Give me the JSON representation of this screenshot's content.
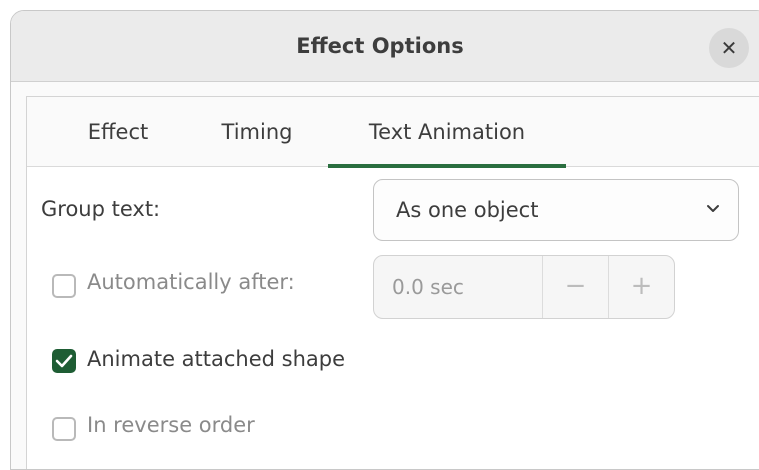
{
  "dialog": {
    "title": "Effect Options",
    "close_icon": "close-icon"
  },
  "tabs": [
    {
      "label": "Effect",
      "active": false
    },
    {
      "label": "Timing",
      "active": false
    },
    {
      "label": "Text Animation",
      "active": true
    }
  ],
  "group_text": {
    "label": "Group text:",
    "value": "As one object"
  },
  "auto_after": {
    "label": "Automatically after:",
    "checked": false,
    "enabled": false,
    "value": "0.0 sec",
    "minus": "−",
    "plus": "+"
  },
  "animate_shape": {
    "label": "Animate attached shape",
    "checked": true
  },
  "reverse_order": {
    "label": "In reverse order",
    "checked": false,
    "enabled": false
  },
  "colors": {
    "accent": "#1e5d34"
  }
}
